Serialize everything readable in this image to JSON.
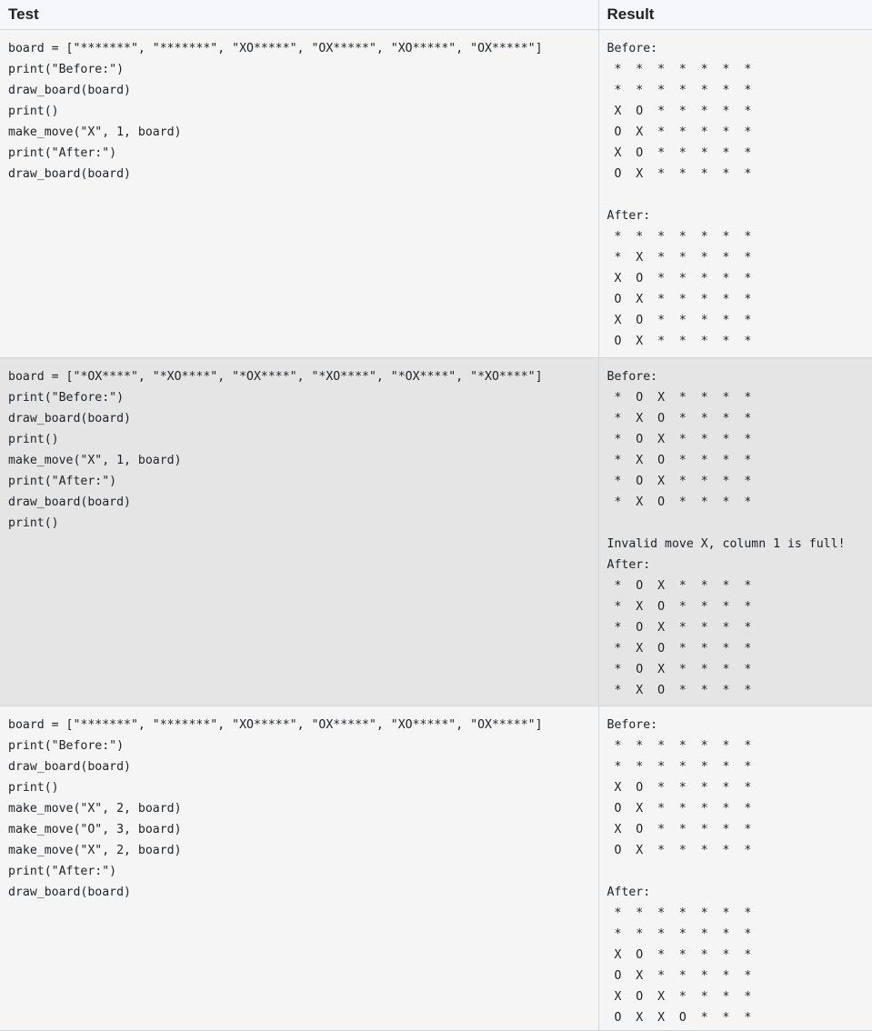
{
  "header": {
    "test_label": "Test",
    "result_label": "Result"
  },
  "rows": [
    {
      "test_code": "board = [\"*******\", \"*******\", \"XO*****\", \"OX*****\", \"XO*****\", \"OX*****\"]\nprint(\"Before:\")\ndraw_board(board)\nprint()\nmake_move(\"X\", 1, board)\nprint(\"After:\")\ndraw_board(board)",
      "result_output": "Before:\n *  *  *  *  *  *  *\n *  *  *  *  *  *  *\n X  O  *  *  *  *  *\n O  X  *  *  *  *  *\n X  O  *  *  *  *  *\n O  X  *  *  *  *  *\n\nAfter:\n *  *  *  *  *  *  *\n *  X  *  *  *  *  *\n X  O  *  *  *  *  *\n O  X  *  *  *  *  *\n X  O  *  *  *  *  *\n O  X  *  *  *  *  *"
    },
    {
      "test_code": "board = [\"*OX****\", \"*XO****\", \"*OX****\", \"*XO****\", \"*OX****\", \"*XO****\"]\nprint(\"Before:\")\ndraw_board(board)\nprint()\nmake_move(\"X\", 1, board)\nprint(\"After:\")\ndraw_board(board)\nprint()",
      "result_output": "Before:\n *  O  X  *  *  *  *\n *  X  O  *  *  *  *\n *  O  X  *  *  *  *\n *  X  O  *  *  *  *\n *  O  X  *  *  *  *\n *  X  O  *  *  *  *\n\nInvalid move X, column 1 is full!\nAfter:\n *  O  X  *  *  *  *\n *  X  O  *  *  *  *\n *  O  X  *  *  *  *\n *  X  O  *  *  *  *\n *  O  X  *  *  *  *\n *  X  O  *  *  *  *"
    },
    {
      "test_code": "board = [\"*******\", \"*******\", \"XO*****\", \"OX*****\", \"XO*****\", \"OX*****\"]\nprint(\"Before:\")\ndraw_board(board)\nprint()\nmake_move(\"X\", 2, board)\nmake_move(\"O\", 3, board)\nmake_move(\"X\", 2, board)\nprint(\"After:\")\ndraw_board(board)",
      "result_output": "Before:\n *  *  *  *  *  *  *\n *  *  *  *  *  *  *\n X  O  *  *  *  *  *\n O  X  *  *  *  *  *\n X  O  *  *  *  *  *\n O  X  *  *  *  *  *\n\nAfter:\n *  *  *  *  *  *  *\n *  *  *  *  *  *  *\n X  O  *  *  *  *  *\n O  X  *  *  *  *  *\n X  O  X  *  *  *  *\n O  X  X  O  *  *  *"
    }
  ]
}
